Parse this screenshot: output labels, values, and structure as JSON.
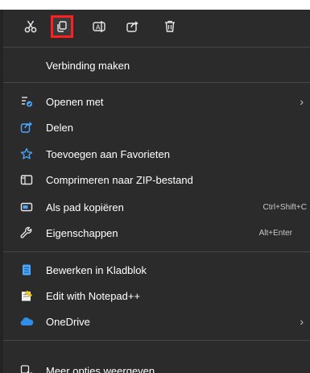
{
  "toolbar": {
    "buttons": [
      {
        "name": "cut",
        "icon": "scissors-icon"
      },
      {
        "name": "copy",
        "icon": "copy-icon",
        "highlighted": true
      },
      {
        "name": "rename",
        "icon": "rename-icon"
      },
      {
        "name": "share",
        "icon": "share-icon"
      },
      {
        "name": "delete",
        "icon": "trash-icon"
      }
    ]
  },
  "menu": {
    "connect": {
      "label": "Verbinding maken"
    },
    "open_with": {
      "label": "Openen met",
      "icon": "open-with-icon",
      "submenu": true
    },
    "share": {
      "label": "Delen",
      "icon": "share-icon"
    },
    "favorites": {
      "label": "Toevoegen aan Favorieten",
      "icon": "star-icon"
    },
    "compress": {
      "label": "Comprimeren naar ZIP-bestand",
      "icon": "zip-folder-icon"
    },
    "copy_path": {
      "label": "Als pad kopiëren",
      "icon": "path-icon",
      "shortcut": "Ctrl+Shift+C"
    },
    "properties": {
      "label": "Eigenschappen",
      "icon": "wrench-icon",
      "shortcut": "Alt+Enter"
    },
    "notepad": {
      "label": "Bewerken in Kladblok",
      "icon": "notepad-icon"
    },
    "notepadpp": {
      "label": "Edit with Notepad++",
      "icon": "notepadpp-icon"
    },
    "onedrive": {
      "label": "OneDrive",
      "icon": "cloud-icon",
      "submenu": true
    },
    "more": {
      "label": "Meer opties weergeven",
      "icon": "more-options-icon"
    }
  },
  "colors": {
    "menu_bg": "#2b2b2b",
    "accent_blue": "#4aa8ff",
    "highlight_red": "#ff1f1f",
    "separator": "#474747"
  }
}
